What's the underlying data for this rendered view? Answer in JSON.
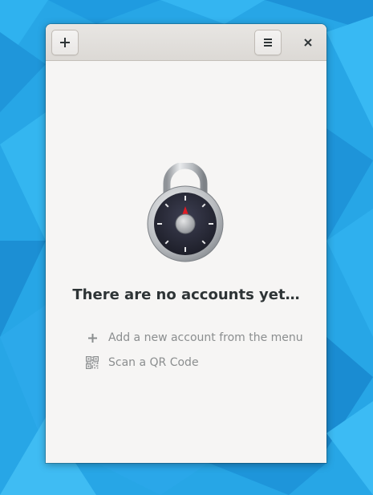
{
  "window": {
    "headerbar": {
      "add_button_icon": "plus-icon",
      "menu_button_icon": "hamburger-menu-icon",
      "close_button_icon": "close-icon"
    },
    "empty_state": {
      "icon": "padlock-icon",
      "title": "There are no accounts yet…",
      "hints": [
        {
          "icon": "plus-icon",
          "label": "Add a new account from the menu"
        },
        {
          "icon": "qr-code-icon",
          "label": "Scan a QR Code"
        }
      ]
    }
  },
  "colors": {
    "desktop_background": "#27a6e6",
    "window_background": "#f6f5f4",
    "title_text": "#2e3436",
    "hint_text": "#8b8e8f",
    "lock_accent": "#e01b24"
  }
}
